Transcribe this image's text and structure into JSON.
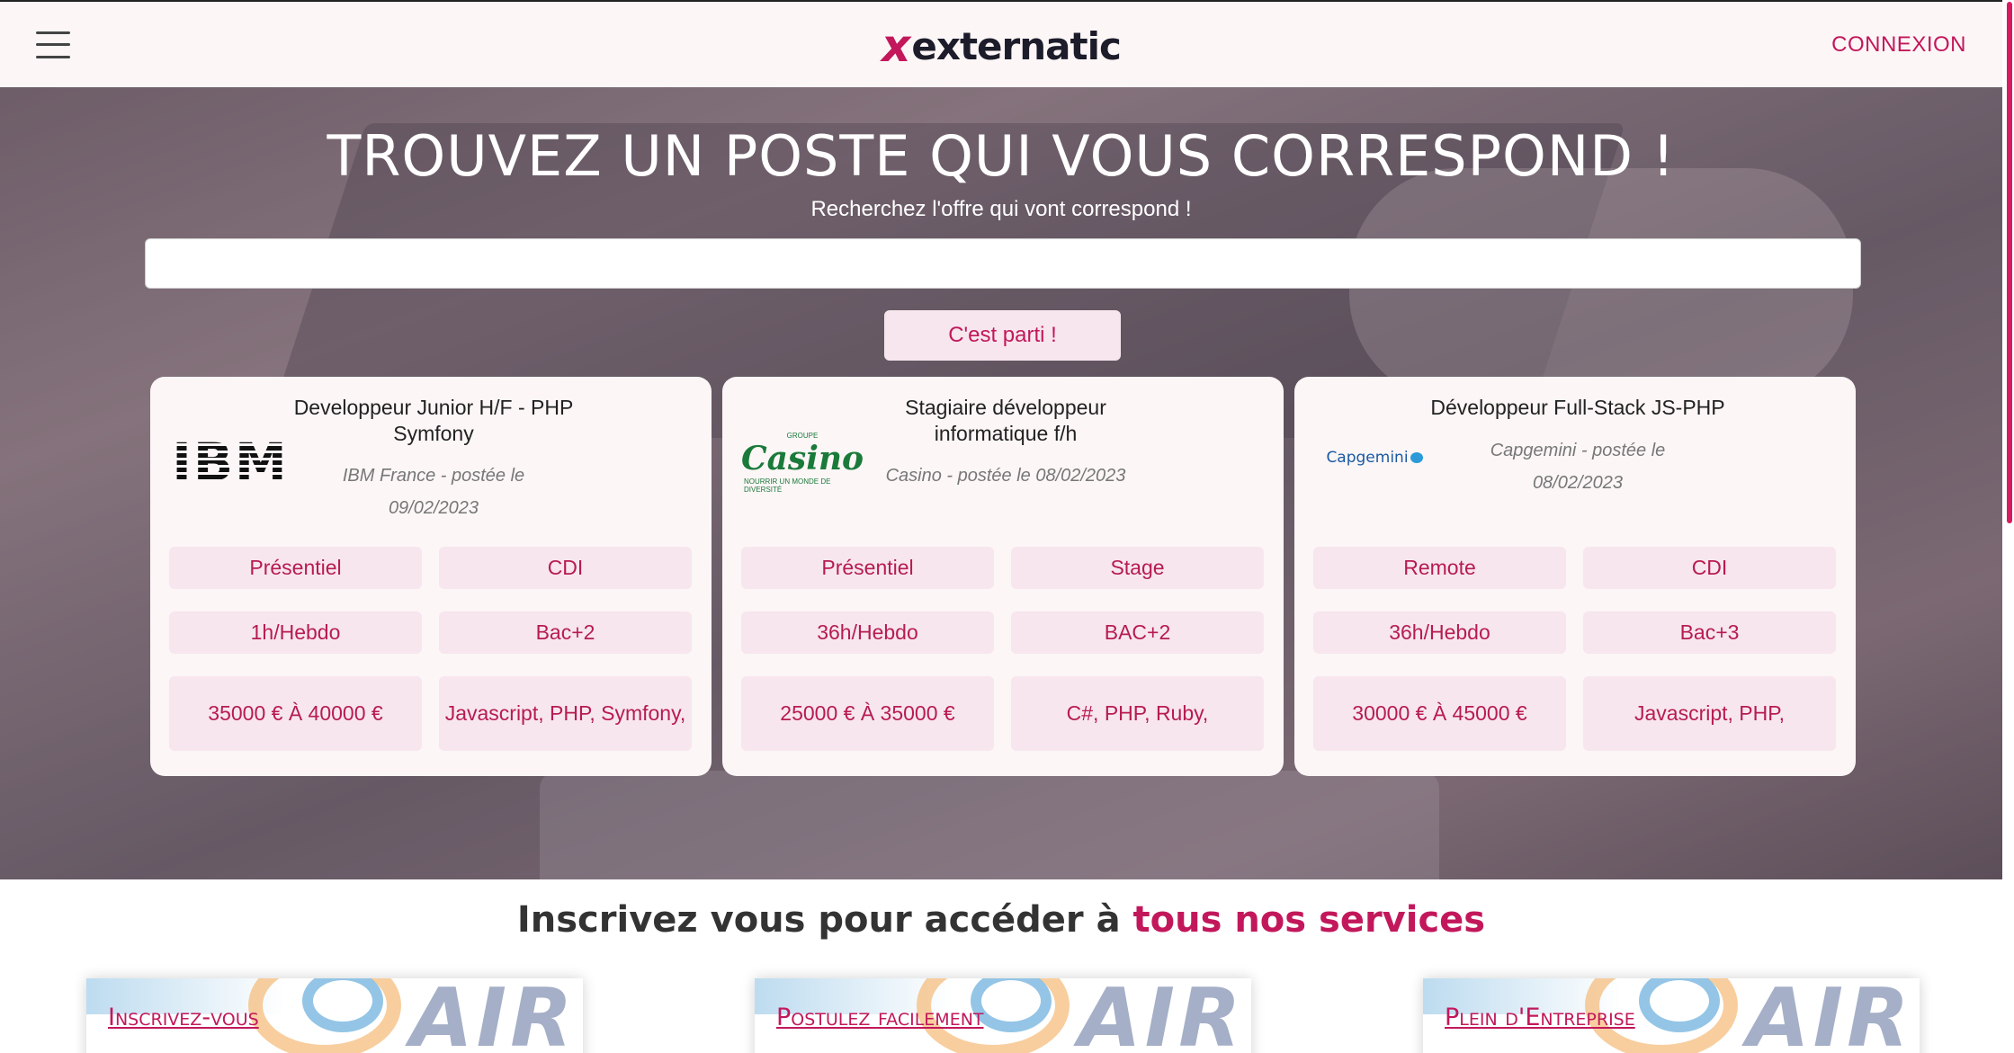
{
  "header": {
    "logo_mark": "x",
    "logo_text": "externatic",
    "login_label": "CONNEXION"
  },
  "hero": {
    "title": "TROUVEZ UN POSTE QUI VOUS CORRESPOND !",
    "subtitle": "Recherchez l'offre qui vont correspond !",
    "search_value": "",
    "search_placeholder": "",
    "submit_label": "C'est parti !"
  },
  "jobs": [
    {
      "logo_icon": "ibm-logo",
      "logo_text": "IBM",
      "title": "Developpeur Junior H/F - PHP Symfony",
      "meta": "IBM France - postée le 09/02/2023",
      "workplace": "Présentiel",
      "contract": "CDI",
      "hours": "1h/Hebdo",
      "education": "Bac+2",
      "salary": "35000 € À 40000 €",
      "skills": "Javascript, PHP, Symfony,"
    },
    {
      "logo_icon": "casino-logo",
      "logo_text": "Casino",
      "logo_small_top": "GROUPE",
      "logo_small_bottom": "NOURRIR UN MONDE DE DIVERSITÉ",
      "title": "Stagiaire développeur informatique f/h",
      "meta": "Casino - postée le 08/02/2023",
      "workplace": "Présentiel",
      "contract": "Stage",
      "hours": "36h/Hebdo",
      "education": "BAC+2",
      "salary": "25000 € À 35000 €",
      "skills": "C#, PHP, Ruby,"
    },
    {
      "logo_icon": "capgemini-logo",
      "logo_text": "Capgemini",
      "title": "Développeur Full-Stack JS-PHP",
      "meta": "Capgemini - postée le 08/02/2023",
      "workplace": "Remote",
      "contract": "CDI",
      "hours": "36h/Hebdo",
      "education": "Bac+3",
      "salary": "30000 € À 45000 €",
      "skills": "Javascript, PHP,"
    }
  ],
  "services": {
    "title_part1": "Inscrivez",
    "title_part2": " vous pour accéder à ",
    "title_accent": "tous nos services",
    "cards": [
      {
        "title": "Inscrivez-vous",
        "text": ""
      },
      {
        "title": "Postulez facilement",
        "text": ""
      },
      {
        "title": "Plein d'Entreprise",
        "text": ""
      }
    ]
  },
  "colors": {
    "brand": "#c2185b",
    "tag_bg": "#f7e6ee",
    "card_bg": "#fcf6f6"
  },
  "icons": {
    "menu": "hamburger-menu-icon",
    "logo_mark": "x-logo-mark"
  }
}
